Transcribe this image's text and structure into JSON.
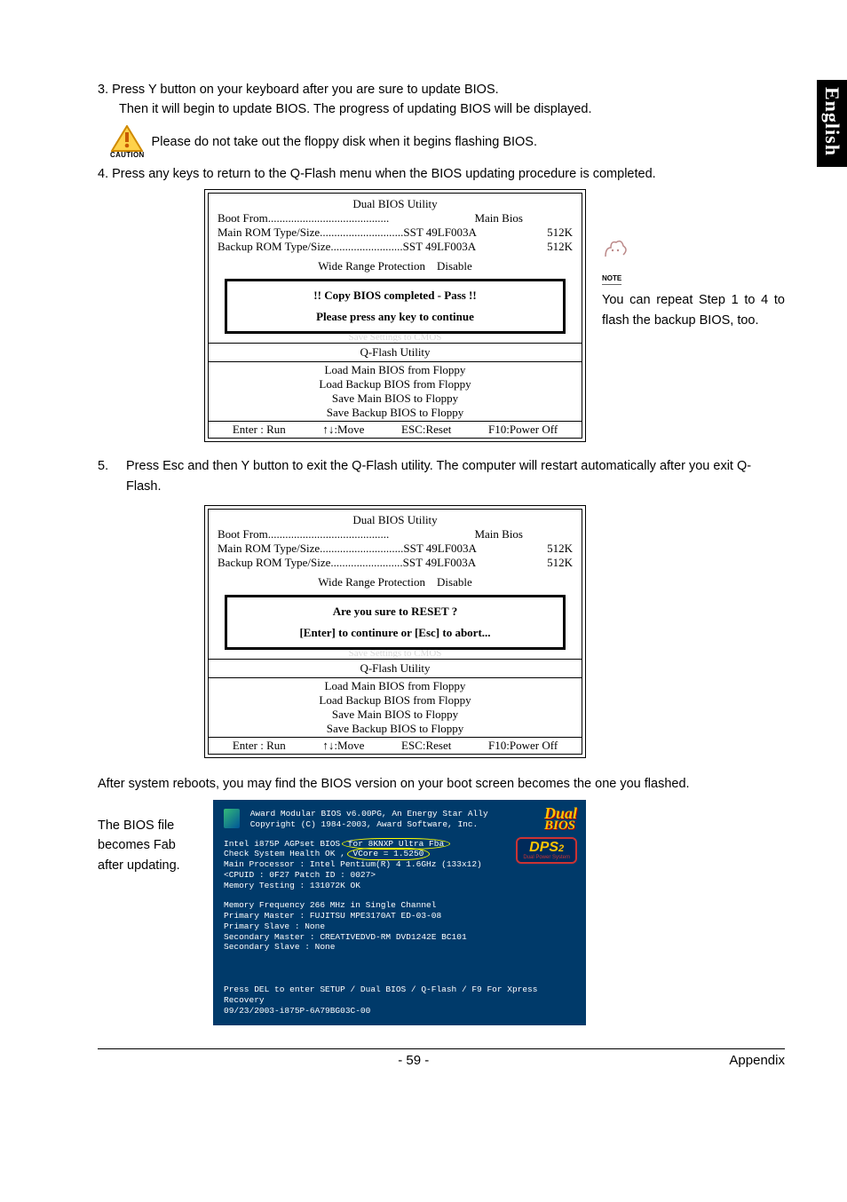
{
  "sideTab": "English",
  "step3_line1": "3. Press Y button on your keyboard after you are sure to update BIOS.",
  "step3_line2": "Then it will begin to update BIOS. The progress of updating BIOS will be displayed.",
  "caution_text": "Please do not take out the floppy disk when it begins flashing BIOS.",
  "caution_label": "CAUTION",
  "step4": "4. Press any keys to return to the Q-Flash menu when the BIOS updating procedure is completed.",
  "bios": {
    "title": "Dual BIOS Utility",
    "boot_from_label": "Boot From..........................................",
    "boot_from_value": "Main Bios",
    "main_rom_label": "Main ROM Type/Size.............................",
    "main_rom_value": "SST 49LF003A",
    "main_rom_size": "512K",
    "backup_rom_label": "Backup ROM Type/Size.........................",
    "backup_rom_value": "SST 49LF003A",
    "backup_rom_size": "512K",
    "wrp": "Wide Range Protection    Disable",
    "copy_msg": "!! Copy BIOS completed - Pass !!",
    "press_any": "Please press any key to continue",
    "reset_msg": "Are you sure to RESET ?",
    "reset_hint": "[Enter] to continure or [Esc] to abort...",
    "qflash_title": "Q-Flash Utility",
    "menu1": "Load Main BIOS from Floppy",
    "menu2": "Load Backup BIOS from Floppy",
    "menu3": "Save Main BIOS to Floppy",
    "menu4": "Save Backup BIOS to Floppy",
    "k_run": "Enter : Run",
    "k_move": "↑↓:Move",
    "k_reset": "ESC:Reset",
    "k_power": "F10:Power Off"
  },
  "note_label": "NOTE",
  "note_text": "You can repeat Step 1 to 4 to flash the backup BIOS, too.",
  "step5_num": "5.",
  "step5_text": "Press Esc and then Y button to exit the Q-Flash utility. The computer will restart automatically after you exit Q-Flash.",
  "after_reboot": "After system reboots, you may find the BIOS version on your boot screen becomes the one you flashed.",
  "post_note": "The BIOS file becomes Fab after updating.",
  "post": {
    "l1": "Award Modular BIOS v6.00PG, An Energy Star Ally",
    "l2": "Copyright  (C) 1984-2003, Award Software,  Inc.",
    "l3a": "Intel i875P AGPset BIOS ",
    "l3b": "for 8KNXP Ultra Fba",
    "l4a": "Check System Health OK , ",
    "l4b": "VCore = 1.5250",
    "l5": "Main Processor : Intel Pentium(R) 4   1.6GHz (133x12)",
    "l6": "<CPUID : 0F27 Patch ID  : 0027>",
    "l7": "Memory Testing  : 131072K OK",
    "l8": "Memory Frequency 266 MHz in Single Channel",
    "l9": "Primary Master : FUJITSU MPE3170AT ED-03-08",
    "l10": "Primary Slave : None",
    "l11": "Secondary Master : CREATIVEDVD-RM DVD1242E BC101",
    "l12": "Secondary Slave : None",
    "l13": "Press DEL to enter SETUP / Dual BIOS / Q-Flash / F9 For Xpress Recovery",
    "l14": "09/23/2003-i875P-6A79BG03C-00",
    "dual1": "Dual",
    "dual2": "BIOS",
    "dps": "DPS",
    "dps_sub": "Dual Power System"
  },
  "footer_page": "- 59 -",
  "footer_section": "Appendix"
}
